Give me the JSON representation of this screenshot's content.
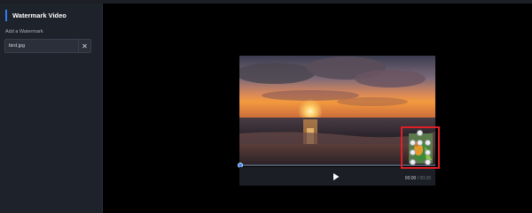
{
  "sidebar": {
    "title": "Watermark Video",
    "section_label": "Add a Watermark",
    "file": {
      "name": "bird.jpg",
      "remove_glyph": "✕"
    }
  },
  "player": {
    "current_time": "00:00",
    "separator": "/",
    "duration": "00:20",
    "progress": 0,
    "play_icon": "play-icon"
  },
  "watermark": {
    "icon": "bird-watermark-image"
  },
  "colors": {
    "accent": "#2e7df6",
    "selection_border": "#e01e25",
    "sidebar_bg": "#1e222b",
    "controls_bg": "#1b1e24"
  }
}
